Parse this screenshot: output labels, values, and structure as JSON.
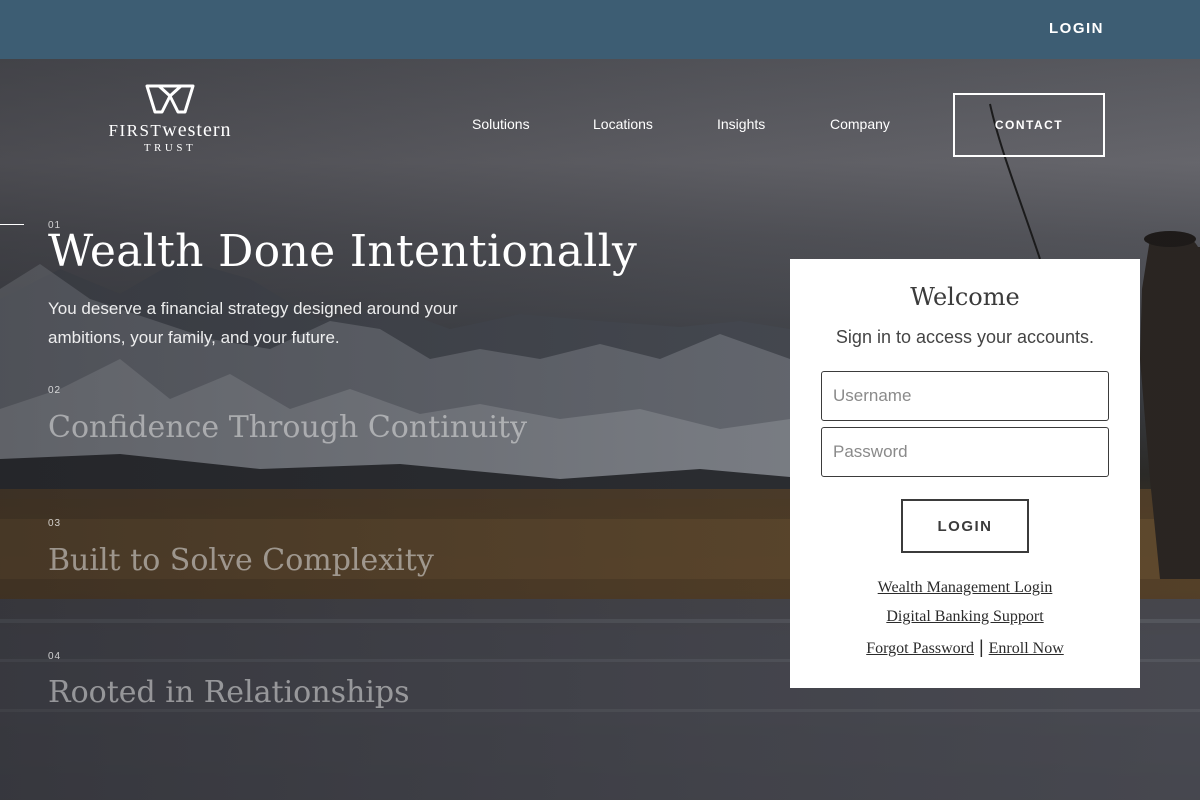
{
  "topbar": {
    "login_label": "LOGIN"
  },
  "logo": {
    "word_caps": "FIRST",
    "word_rest": "western",
    "sub": "TRUST"
  },
  "nav": {
    "items": [
      "Solutions",
      "Locations",
      "Insights",
      "Company"
    ],
    "contact_label": "CONTACT"
  },
  "slides": [
    {
      "num": "01",
      "title": "Wealth Done Intentionally",
      "description": "You deserve a financial strategy designed around your ambitions, your family, and your future."
    },
    {
      "num": "02",
      "title": "Confidence Through Continuity"
    },
    {
      "num": "03",
      "title": "Built to Solve Complexity"
    },
    {
      "num": "04",
      "title": "Rooted in Relationships"
    }
  ],
  "login_card": {
    "title": "Welcome",
    "subtitle": "Sign in to access your accounts.",
    "username_placeholder": "Username",
    "password_placeholder": "Password",
    "login_label": "LOGIN",
    "links": {
      "wealth_management": "Wealth Management Login",
      "digital_banking": "Digital Banking Support",
      "forgot_password": "Forgot Password",
      "separator": "|",
      "enroll": "Enroll Now"
    }
  },
  "colors": {
    "topbar": "#3d5d73",
    "card_bg": "#ffffff",
    "text_dark": "#3b3b3b"
  }
}
